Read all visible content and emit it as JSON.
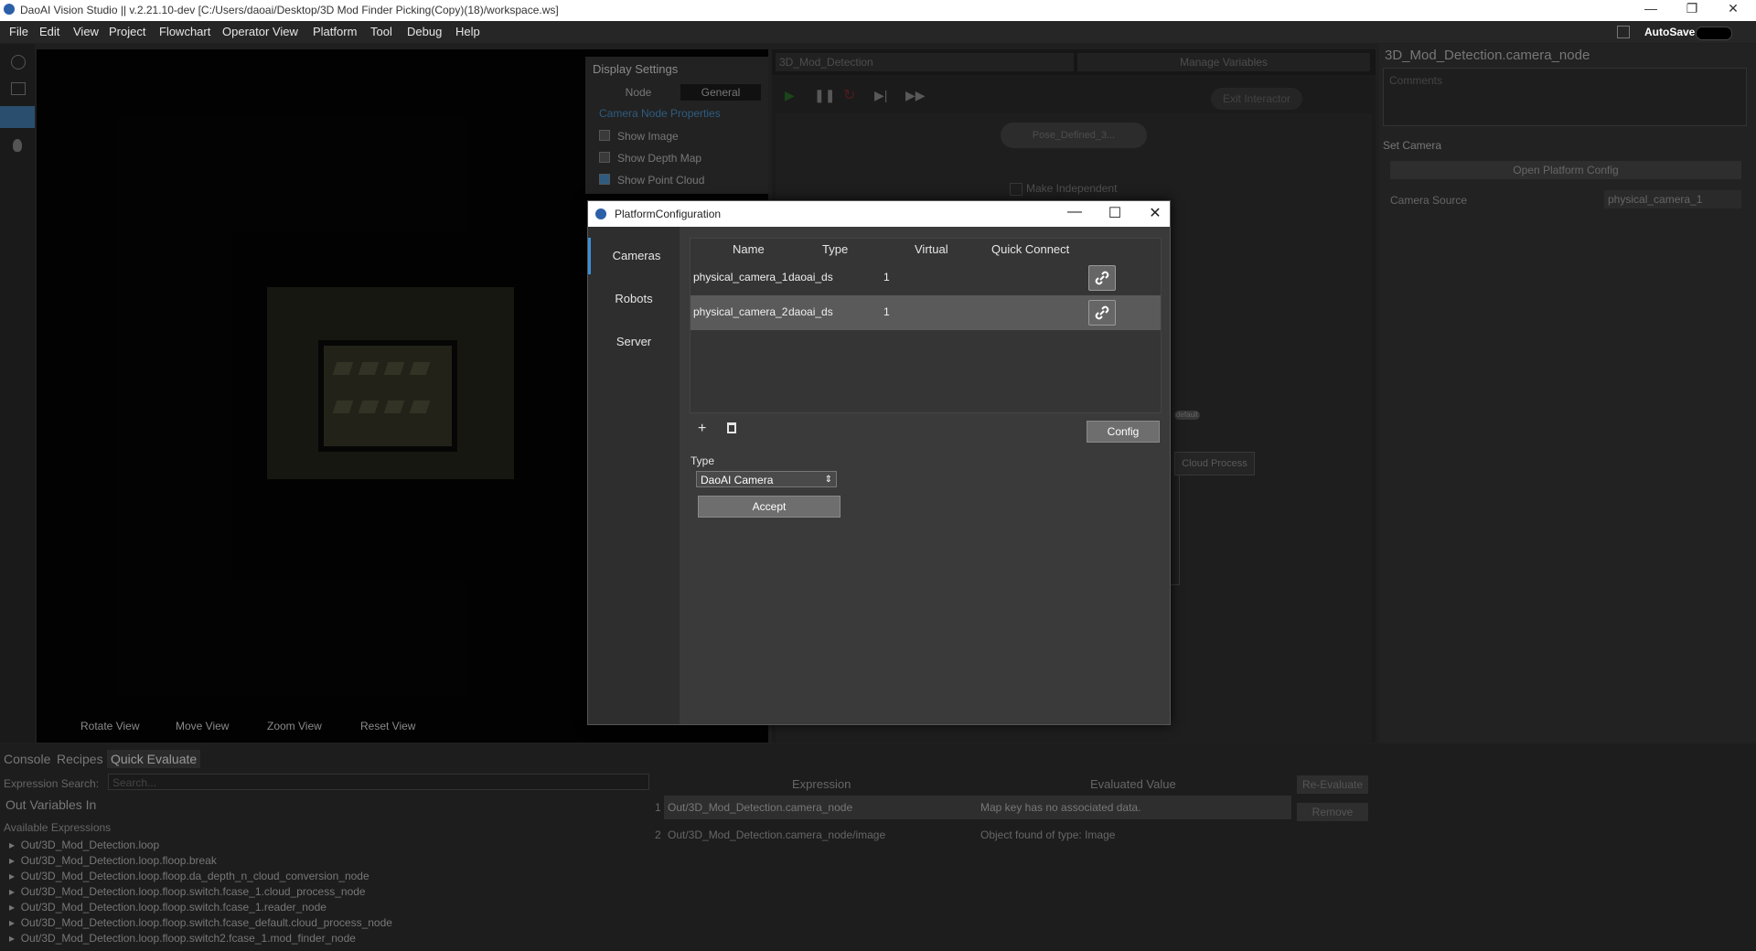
{
  "window": {
    "title": "DaoAI Vision Studio || v.2.21.10-dev   [C:/Users/daoai/Desktop/3D Mod Finder Picking(Copy)(18)/workspace.ws]",
    "controls": [
      "—",
      "❐",
      "✕"
    ]
  },
  "menu": {
    "items": [
      "File",
      "Edit",
      "View",
      "Project",
      "Flowchart",
      "Operator View",
      "Platform",
      "Tool",
      "Debug",
      "Help"
    ],
    "autosave": "AutoSave"
  },
  "display_settings": {
    "header": "Display Settings",
    "tabs": [
      "Node",
      "General"
    ],
    "section": "Camera Node Properties",
    "checkboxes": [
      {
        "label": "Show Image",
        "checked": false
      },
      {
        "label": "Show Depth Map",
        "checked": false
      },
      {
        "label": "Show Point Cloud",
        "checked": true
      }
    ]
  },
  "viewport": {
    "buttons": [
      "Rotate View",
      "Move View",
      "Zoom View",
      "Reset View"
    ]
  },
  "flowchart": {
    "selector": "3D_Mod_Detection",
    "manage_variables": "Manage Variables",
    "exit_interactor": "Exit Interactor",
    "node_top": "Pose_Defined_3...",
    "make_independent": "Make Independent",
    "cloud_process": "Cloud Process",
    "default_tag": "default"
  },
  "right_panel": {
    "title": "3D_Mod_Detection.camera_node",
    "comments_placeholder": "Comments",
    "section": "Set Camera",
    "open_platform_config": "Open Platform Config",
    "camera_source_label": "Camera Source",
    "camera_source_value": "physical_camera_1"
  },
  "bottom": {
    "tabs": [
      "Console",
      "Recipes",
      "Quick Evaluate"
    ],
    "expression_search_label": "Expression Search:",
    "expression_search_placeholder": "Search...",
    "out_vars": "Out Variables In",
    "available": "Available Expressions",
    "tree": [
      "Out/3D_Mod_Detection.loop",
      "Out/3D_Mod_Detection.loop.floop.break",
      "Out/3D_Mod_Detection.loop.floop.da_depth_n_cloud_conversion_node",
      "Out/3D_Mod_Detection.loop.floop.switch.fcase_1.cloud_process_node",
      "Out/3D_Mod_Detection.loop.floop.switch.fcase_1.reader_node",
      "Out/3D_Mod_Detection.loop.floop.switch.fcase_default.cloud_process_node",
      "Out/3D_Mod_Detection.loop.floop.switch2.fcase_1.mod_finder_node"
    ],
    "expr_headers": [
      "Expression",
      "Evaluated Value"
    ],
    "expressions": [
      {
        "num": "1",
        "expr": "Out/3D_Mod_Detection.camera_node",
        "value": "Map key has no associated data."
      },
      {
        "num": "2",
        "expr": "Out/3D_Mod_Detection.camera_node/image",
        "value": "Object found of type: Image"
      }
    ],
    "re_evaluate": "Re-Evaluate",
    "remove": "Remove"
  },
  "dialog": {
    "title": "PlatformConfiguration",
    "sidebar": [
      "Cameras",
      "Robots",
      "Server"
    ],
    "columns": [
      "Name",
      "Type",
      "Virtual",
      "Quick Connect"
    ],
    "rows": [
      {
        "name": "physical_camera_1",
        "type": "daoai_ds",
        "virtual": "1"
      },
      {
        "name": "physical_camera_2",
        "type": "daoai_ds",
        "virtual": "1"
      }
    ],
    "add_icon": "+",
    "config_button": "Config",
    "type_label": "Type",
    "type_value": "DaoAI Camera",
    "accept_button": "Accept"
  }
}
